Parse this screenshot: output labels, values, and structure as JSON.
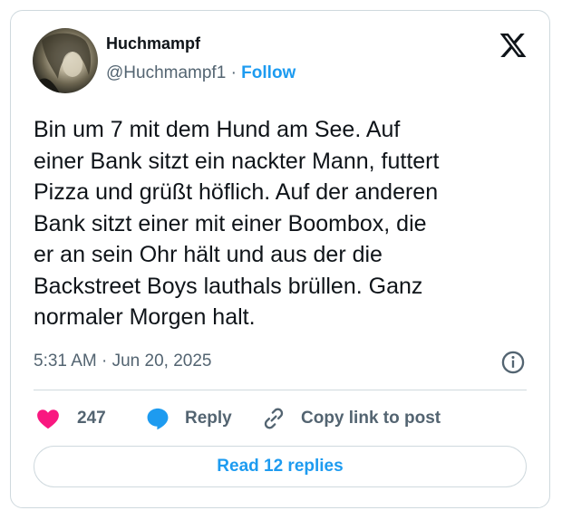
{
  "tweet": {
    "author_name": "Huchmampf",
    "handle": "@Huchmampf1",
    "separator": "·",
    "follow_label": "Follow",
    "text": "Bin um 7 mit dem Hund am See. Auf\neiner Bank sitzt ein nackter Mann, futtert\nPizza und grüßt höflich. Auf der anderen\nBank sitzt einer mit einer Boombox, die\ner an sein Ohr hält und aus der die\nBackstreet Boys lauthals brüllen. Ganz\nnormaler Morgen halt.",
    "timestamp": "5:31 AM · Jun 20, 2025",
    "likes": "247",
    "reply_label": "Reply",
    "copy_link_label": "Copy link to post",
    "read_replies_label": "Read 12 replies"
  },
  "icons": {
    "brand": "x-logo-icon",
    "info": "info-icon",
    "like": "heart-icon",
    "reply": "speech-bubble-icon",
    "copy": "link-icon"
  },
  "colors": {
    "accent": "#1d9bf0",
    "like": "#f91880",
    "text": "#0f1419",
    "secondary": "#536471",
    "border": "#cfd9de"
  }
}
